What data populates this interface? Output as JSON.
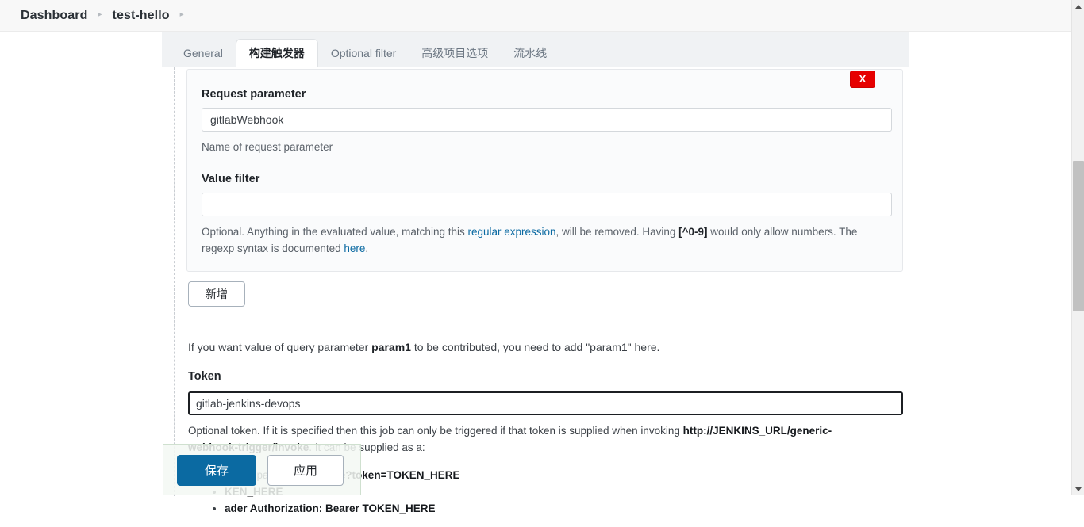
{
  "breadcrumb": {
    "items": [
      "Dashboard",
      "test-hello"
    ],
    "separator": "▸",
    "trailing_separator": "▸"
  },
  "tabs": [
    {
      "label": "General",
      "active": false
    },
    {
      "label": "构建触发器",
      "active": true
    },
    {
      "label": "Optional filter",
      "active": false
    },
    {
      "label": "高级项目选项",
      "active": false
    },
    {
      "label": "流水线",
      "active": false
    }
  ],
  "form": {
    "delete_button_label": "X",
    "request_parameter": {
      "label": "Request parameter",
      "value": "gitlabWebhook",
      "placeholder": "",
      "help": "Name of request parameter"
    },
    "value_filter": {
      "label": "Value filter",
      "value": "",
      "placeholder": "",
      "help_part1": "Optional. Anything in the evaluated value, matching this ",
      "help_link1": "regular expression",
      "help_part2": ", will be removed. Having ",
      "help_bold1": "[^0-9]",
      "help_part3": " would only allow numbers. The regexp syntax is documented ",
      "help_link2": "here",
      "help_part4": "."
    },
    "add_button_label": "新增",
    "param_note_part1": "If you want value of query parameter ",
    "param_note_bold": "param1",
    "param_note_part2": " to be contributed, you need to add \"param1\" here.",
    "token": {
      "label": "Token",
      "value": "gitlab-jenkins-devops",
      "placeholder": "",
      "help_part1": "Optional token. If it is specified then this job can only be triggered if that token is supplied when invoking ",
      "help_bold1": "http://JENKINS_URL/generic-webhook-trigger/invoke",
      "help_part2": ". It can be supplied as a:"
    },
    "token_bullets": [
      {
        "text_plain": "Query parameter ",
        "text_mono": "/invoke?token=TOKEN_HERE"
      },
      {
        "text_plain": "",
        "text_mono": "KEN_HERE"
      },
      {
        "text_plain": "",
        "text_mono": "ader Authorization: Bearer TOKEN_HERE"
      }
    ]
  },
  "save_bar": {
    "save_label": "保存",
    "apply_label": "应用"
  },
  "colors": {
    "accent_blue": "#0b6aa2",
    "danger_red": "#e60000",
    "link_blue": "#0b6aa2",
    "tab_bar_bg": "#f0f2f4",
    "panel_bg": "#fafbfc",
    "save_bar_bg": "#f3f8f3"
  },
  "scrollbar": {
    "up_arrow": "scroll-up",
    "down_arrow": "scroll-down",
    "thumb": "scroll-thumb"
  }
}
